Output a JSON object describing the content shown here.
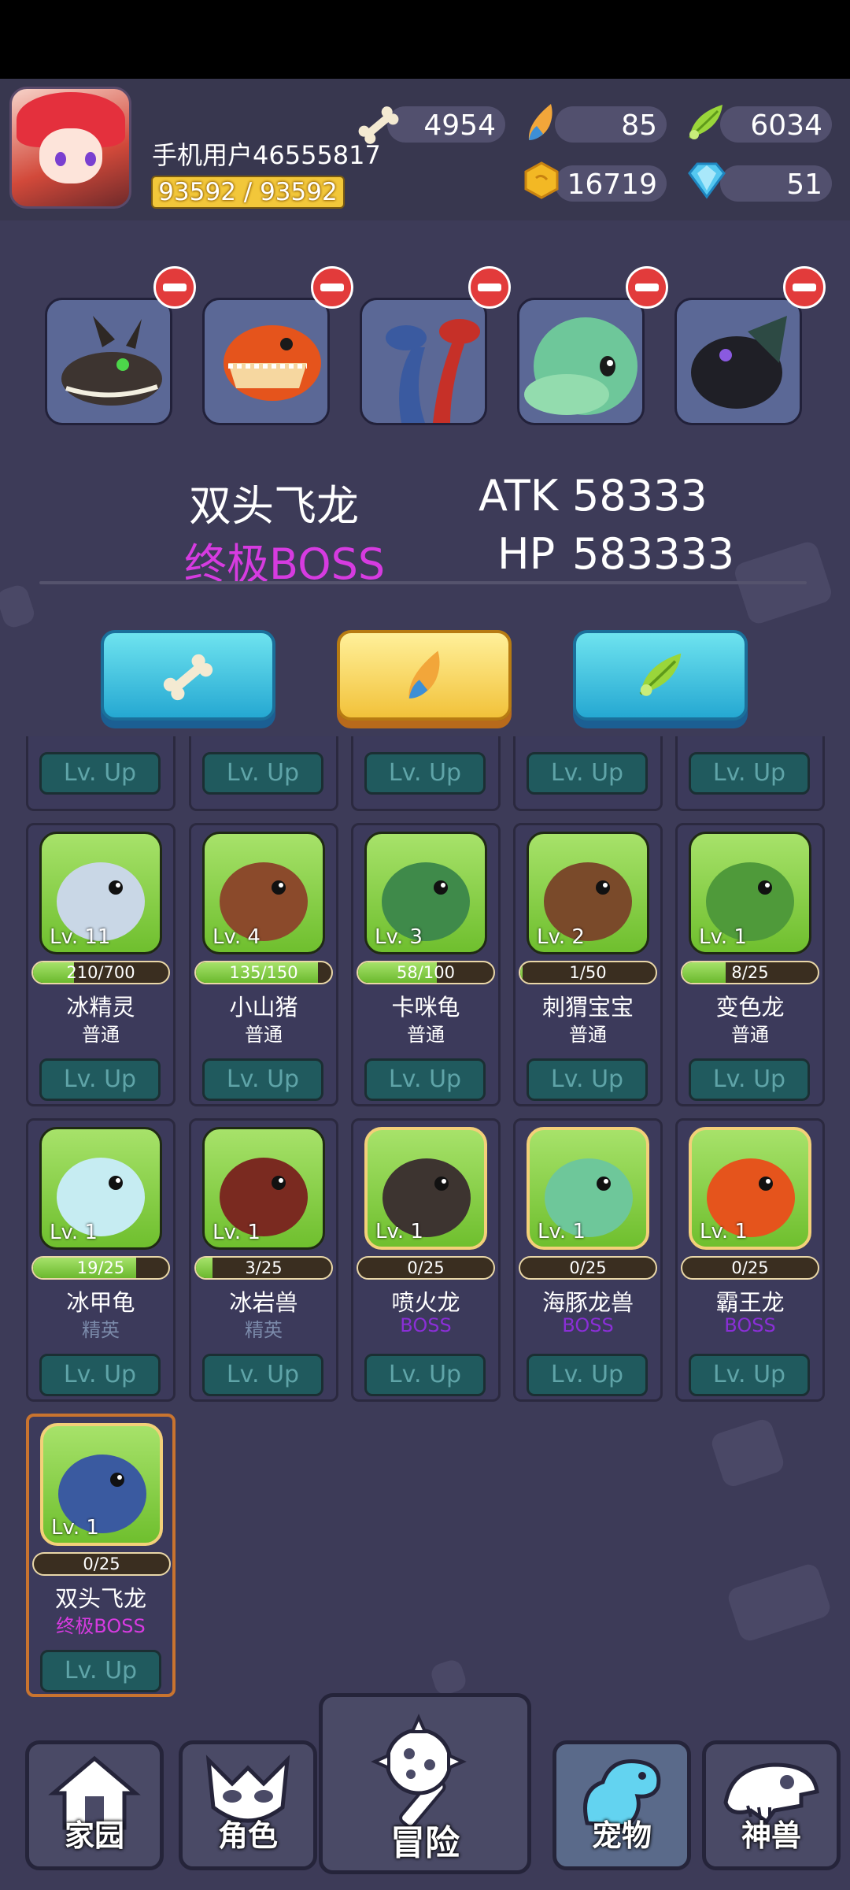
{
  "player": {
    "name": "手机用户46555817",
    "hp": "93592 / 93592"
  },
  "resources": {
    "bone": "4954",
    "horn": "85",
    "leaf": "6034",
    "gold": "16719",
    "gem": "51"
  },
  "team": [
    "dark-dragon",
    "orange-trex",
    "two-headed-dragon",
    "green-dino",
    "black-dragon"
  ],
  "selected": {
    "name": "双头飞龙",
    "tier": "终极BOSS",
    "atk_label": "ATK",
    "atk": "58333",
    "hp_label": "HP",
    "hp": "583333"
  },
  "level_up_label": "Lv. Up",
  "pets": [
    {
      "name": "冰精灵",
      "tier": "普通",
      "level": "Lv. 11",
      "progress": "210/700",
      "fill": 0.3,
      "color": "#c9d7e6"
    },
    {
      "name": "小山猪",
      "tier": "普通",
      "level": "Lv. 4",
      "progress": "135/150",
      "fill": 0.9,
      "color": "#8b4a2b"
    },
    {
      "name": "卡咪龟",
      "tier": "普通",
      "level": "Lv. 3",
      "progress": "58/100",
      "fill": 0.58,
      "color": "#3f8a4a"
    },
    {
      "name": "刺猬宝宝",
      "tier": "普通",
      "level": "Lv. 2",
      "progress": "1/50",
      "fill": 0.02,
      "color": "#7a4a2a"
    },
    {
      "name": "变色龙",
      "tier": "普通",
      "level": "Lv. 1",
      "progress": "8/25",
      "fill": 0.32,
      "color": "#4f9a3a"
    },
    {
      "name": "冰甲龟",
      "tier": "精英",
      "level": "Lv. 1",
      "progress": "19/25",
      "fill": 0.76,
      "color": "#c6ecf2"
    },
    {
      "name": "冰岩兽",
      "tier": "精英",
      "level": "Lv. 1",
      "progress": "3/25",
      "fill": 0.12,
      "color": "#7a2a20"
    },
    {
      "name": "喷火龙",
      "tier": "BOSS",
      "level": "Lv. 1",
      "progress": "0/25",
      "fill": 0,
      "color": "#3d3430"
    },
    {
      "name": "海豚龙兽",
      "tier": "BOSS",
      "level": "Lv. 1",
      "progress": "0/25",
      "fill": 0,
      "color": "#6ec79a"
    },
    {
      "name": "霸王龙",
      "tier": "BOSS",
      "level": "Lv. 1",
      "progress": "0/25",
      "fill": 0,
      "color": "#e5541c"
    },
    {
      "name": "双头飞龙",
      "tier": "终极BOSS",
      "level": "Lv. 1",
      "progress": "0/25",
      "fill": 0,
      "color": "#3a5aa0"
    }
  ],
  "nav": {
    "home": "家园",
    "character": "角色",
    "adventure": "冒险",
    "pets": "宠物",
    "beasts": "神兽"
  }
}
